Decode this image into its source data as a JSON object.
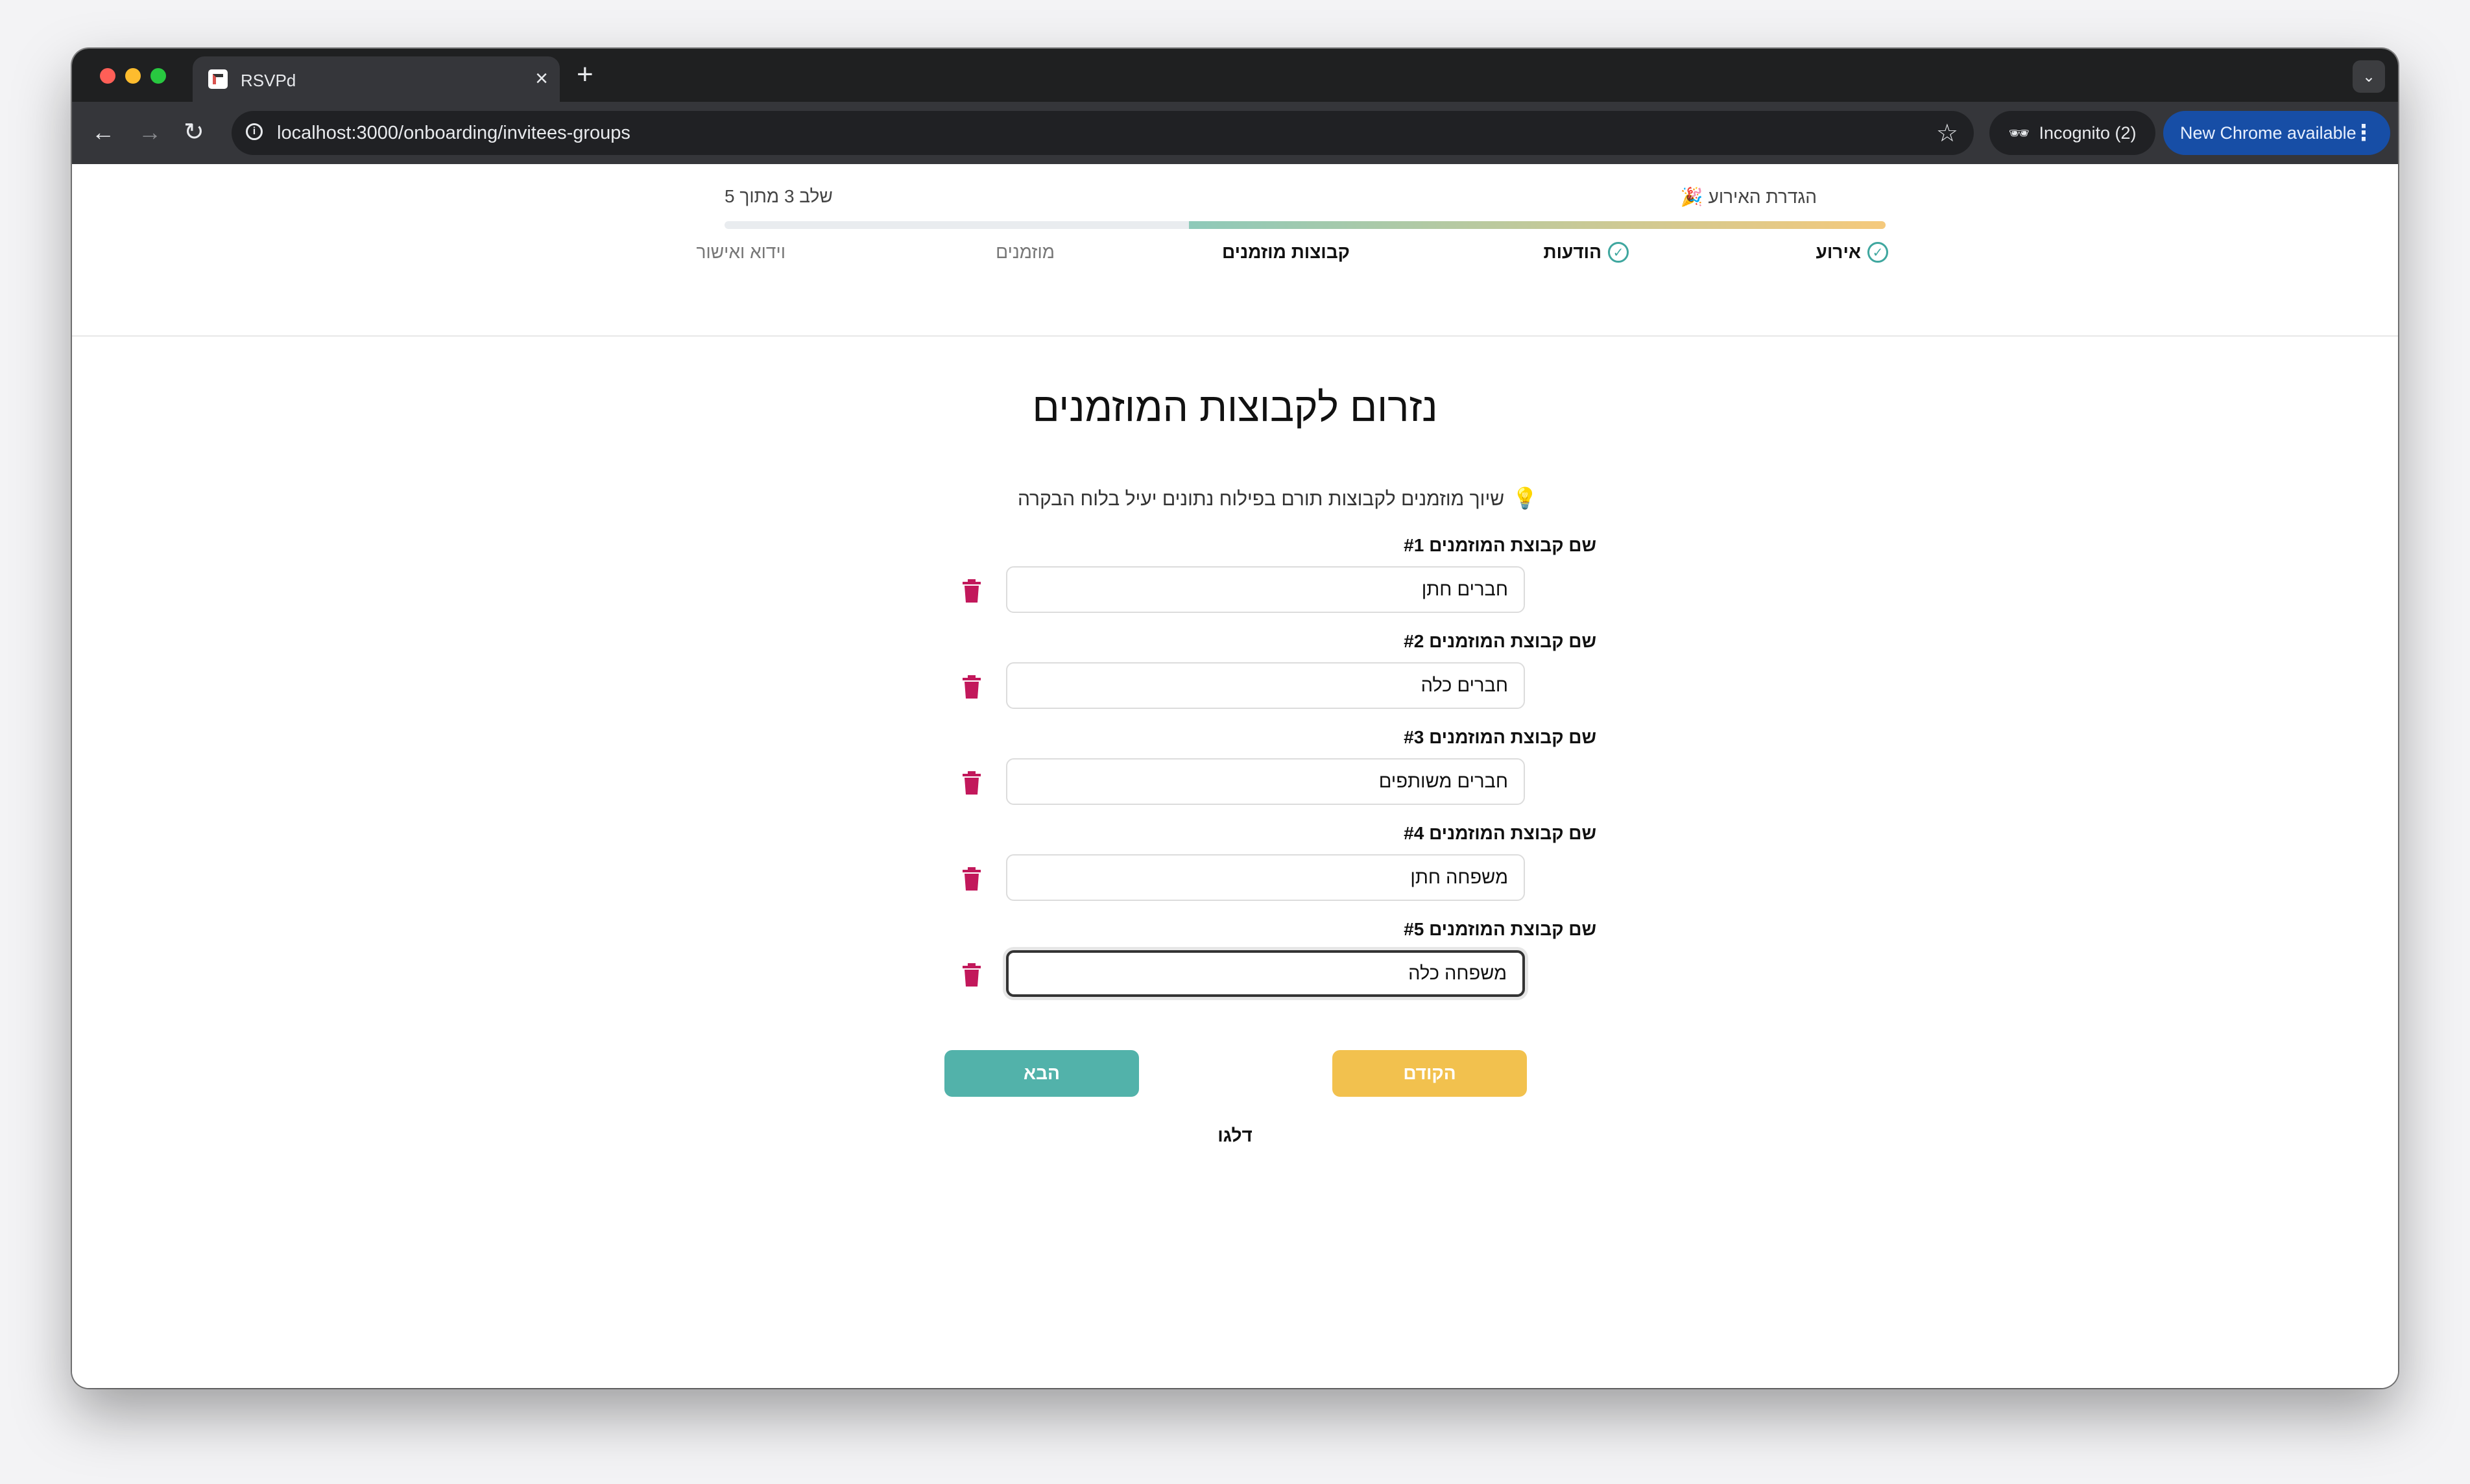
{
  "browser": {
    "tab_title": "RSVPd",
    "tab_close": "×",
    "new_tab": "+",
    "url": "localhost:3000/onboarding/invitees-groups",
    "incognito_label": "Incognito (2)",
    "update_label": "New Chrome available"
  },
  "stepper": {
    "count": "שלב 3 מתוך 5",
    "title": "הגדרת האירוע 🎉",
    "progress_fraction": 0.6,
    "steps": [
      {
        "label": "אירוע",
        "state": "done"
      },
      {
        "label": "הודעות",
        "state": "done"
      },
      {
        "label": "קבוצות מוזמנים",
        "state": "current"
      },
      {
        "label": "מוזמנים",
        "state": "upcoming"
      },
      {
        "label": "וידוא ואישור",
        "state": "upcoming"
      }
    ]
  },
  "page": {
    "heading": "נזרום לקבוצות המוזמנים",
    "tip": "שיוך מוזמנים לקבוצות תורם בפילוח נתונים יעיל בלוח הבקרה",
    "groups": [
      {
        "label": "שם קבוצת המוזמנים #1",
        "value": "חברים חתן"
      },
      {
        "label": "שם קבוצת המוזמנים #2",
        "value": "חברים כלה"
      },
      {
        "label": "שם קבוצת המוזמנים #3",
        "value": "חברים משותפים"
      },
      {
        "label": "שם קבוצת המוזמנים #4",
        "value": "משפחה חתן"
      },
      {
        "label": "שם קבוצת המוזמנים #5",
        "value": "משפחה כלה"
      }
    ],
    "next_label": "הבא",
    "prev_label": "הקודם",
    "skip_label": "דלגו"
  },
  "colors": {
    "primary": "#52b2aa",
    "secondary": "#f2c14e",
    "trash": "#c2185b",
    "check": "#3fa79f"
  }
}
